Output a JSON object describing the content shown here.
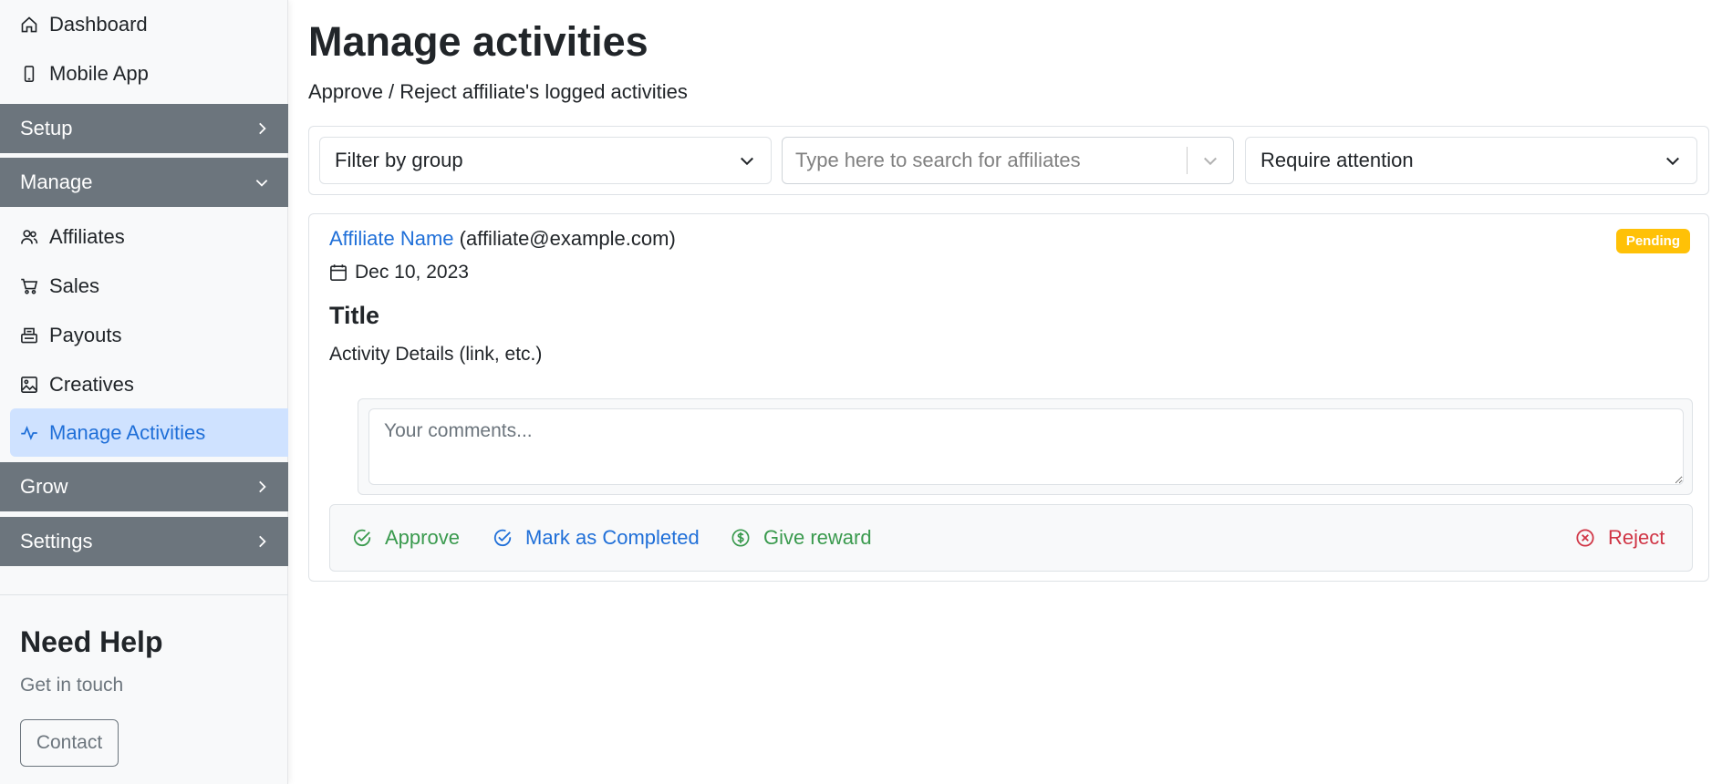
{
  "sidebar": {
    "top_items": [
      {
        "label": "Dashboard",
        "icon": "house-icon"
      },
      {
        "label": "Mobile App",
        "icon": "phone-icon"
      }
    ],
    "sections": {
      "setup": "Setup",
      "manage": "Manage",
      "grow": "Grow",
      "settings": "Settings"
    },
    "manage_items": [
      {
        "label": "Affiliates",
        "icon": "people-icon"
      },
      {
        "label": "Sales",
        "icon": "cart-icon"
      },
      {
        "label": "Payouts",
        "icon": "cash-register-icon"
      },
      {
        "label": "Creatives",
        "icon": "image-icon"
      },
      {
        "label": "Manage Activities",
        "icon": "activity-icon"
      }
    ],
    "help": {
      "title": "Need Help",
      "subtitle": "Get in touch",
      "contact_label": "Contact"
    }
  },
  "main": {
    "title": "Manage activities",
    "subtitle": "Approve / Reject affiliate's logged activities",
    "filters": {
      "group_value": "Filter by group",
      "search_placeholder": "Type here to search for affiliates",
      "status_value": "Require attention"
    },
    "activity": {
      "affiliate_name": "Affiliate Name",
      "affiliate_email": "(affiliate@example.com)",
      "status": "Pending",
      "date": "Dec 10, 2023",
      "title": "Title",
      "details": "Activity Details (link, etc.)",
      "comment_placeholder": "Your comments...",
      "actions": {
        "approve": "Approve",
        "mark_completed": "Mark as Completed",
        "give_reward": "Give reward",
        "reject": "Reject"
      }
    }
  },
  "colors": {
    "section_bg": "#6c757d",
    "active_bg": "#cfe2ff",
    "primary": "#1f6fd8",
    "success": "#3a9a4e",
    "danger": "#d03545",
    "warning": "#ffc107"
  }
}
